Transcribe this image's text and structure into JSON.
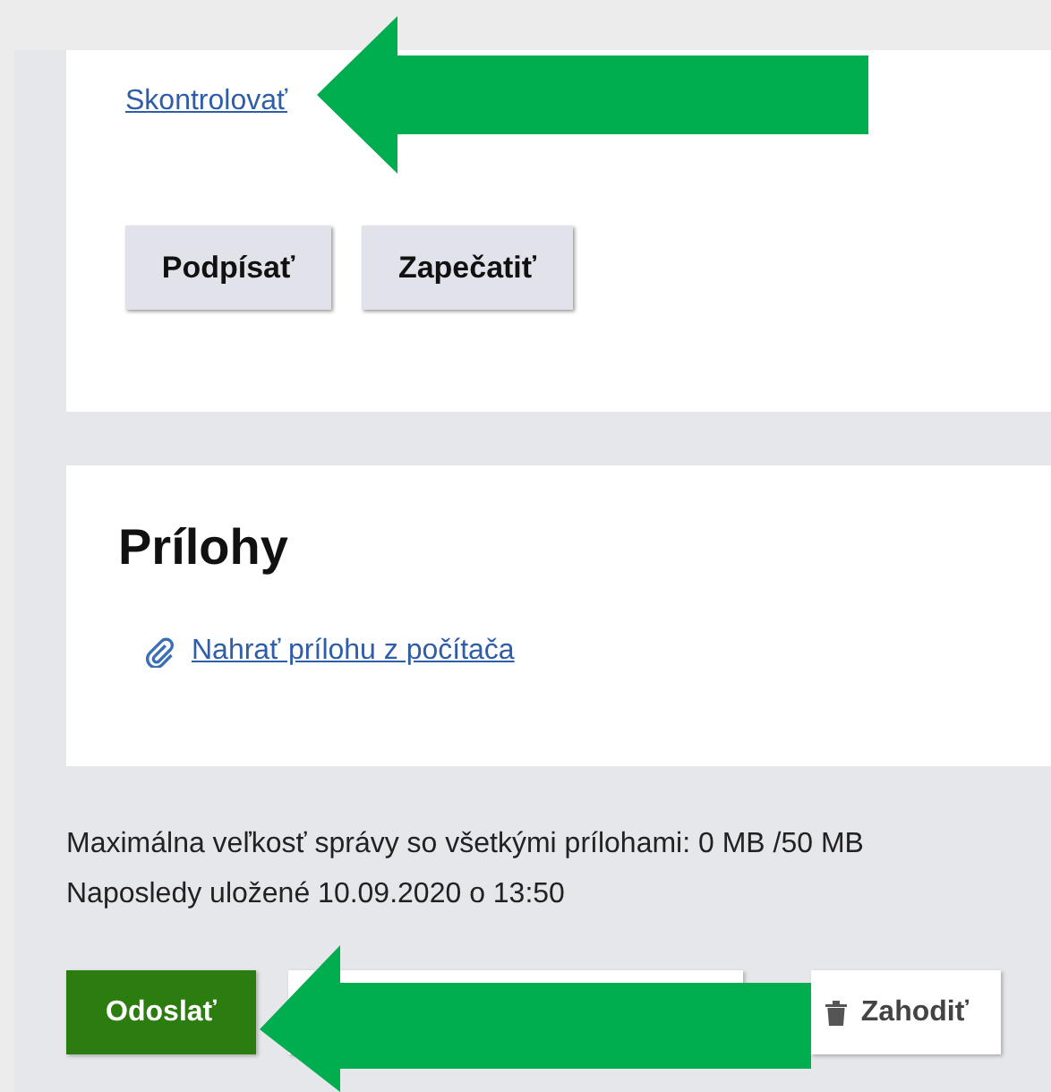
{
  "check_link": "Skontrolovať",
  "card_buttons": [
    "Podpísať",
    "Zapečatiť"
  ],
  "attachments": {
    "title": "Prílohy",
    "upload_link": "Nahrať prílohu z počítača"
  },
  "info": [
    "Maximálna veľkosť správy so všetkými prílohami: 0 MB /50 MB",
    "Naposledy uložené 10.09.2020 o 13:50"
  ],
  "actions": [
    {
      "kind": "primary",
      "label": "Odoslať"
    },
    {
      "kind": "hidden"
    },
    {
      "kind": "discard",
      "label": "Zahodiť"
    }
  ]
}
